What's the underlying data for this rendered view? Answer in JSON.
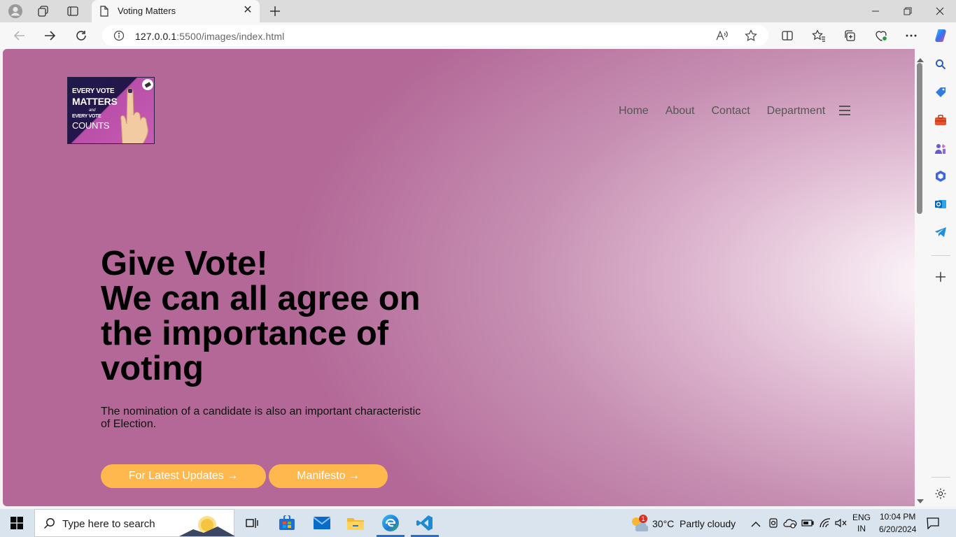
{
  "browser": {
    "tab_title": "Voting Matters",
    "url_host": "127.0.0.1",
    "url_rest": ":5500/images/index.html"
  },
  "page": {
    "logo": {
      "line1": "EVERY VOTE",
      "line2": "MATTERS",
      "line3": "and",
      "line4": "EVERY VOTE",
      "line5": "COUNTS"
    },
    "nav": [
      "Home",
      "About",
      "Contact",
      "Department"
    ],
    "hero": {
      "title_lines": [
        "Give Vote!",
        "We can all agree on",
        "the importance of",
        "voting"
      ],
      "subtitle": "The nomination of a candidate is also an important characteristic of Election."
    },
    "buttons": {
      "updates": "For Latest Updates →",
      "manifesto": "Manifesto →"
    }
  },
  "taskbar": {
    "search_placeholder": "Type here to search",
    "weather_temp": "30°C",
    "weather_desc": "Partly cloudy",
    "weather_badge": "1",
    "lang_top": "ENG",
    "lang_bottom": "IN",
    "time": "10:04 PM",
    "date": "6/20/2024"
  },
  "colors": {
    "accent_button": "#ffb84d",
    "page_gradient_edge": "#b36897",
    "page_gradient_center": "#ffffff"
  }
}
